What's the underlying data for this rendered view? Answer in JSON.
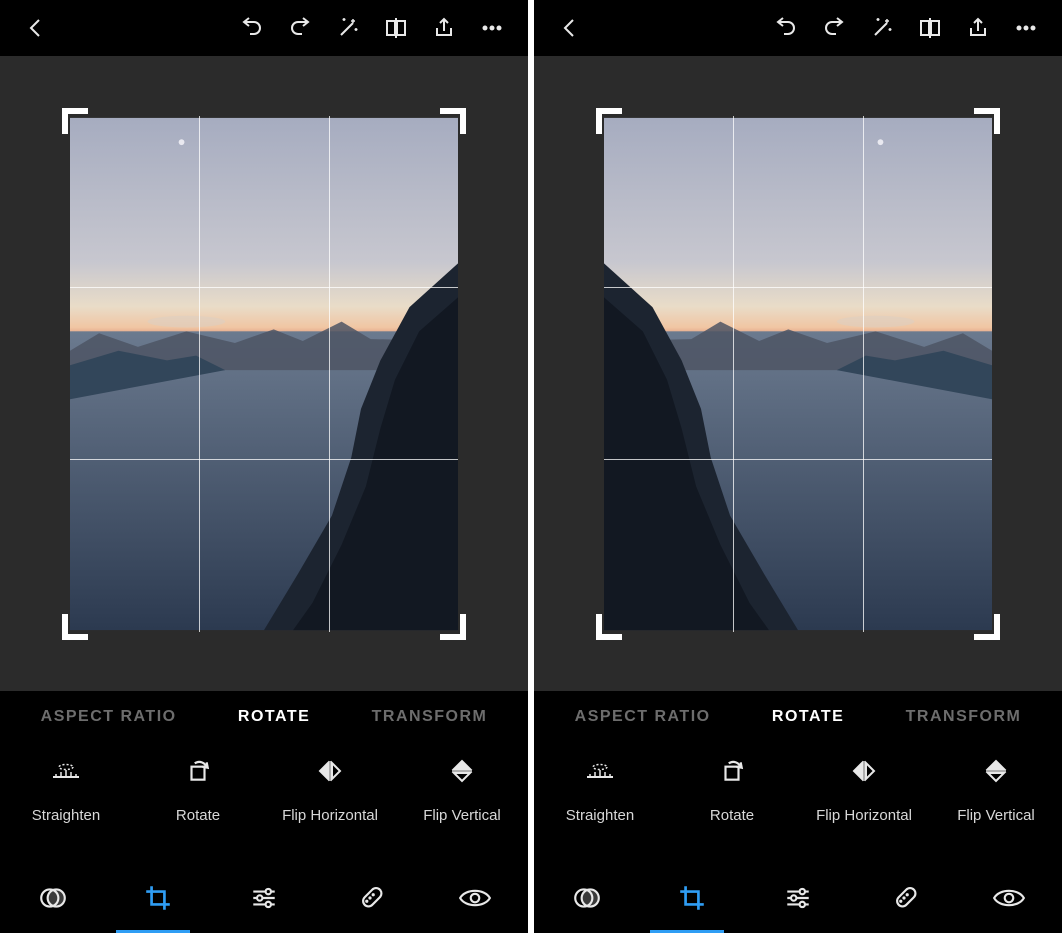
{
  "colors": {
    "accent": "#2f9df4"
  },
  "panels": [
    {
      "flip": false,
      "compareSelected": false
    },
    {
      "flip": true,
      "compareSelected": true
    }
  ],
  "modes": {
    "aspect_ratio": "ASPECT RATIO",
    "rotate": "ROTATE",
    "transform": "TRANSFORM",
    "active": "rotate"
  },
  "tools": {
    "straighten": "Straighten",
    "rotate": "Rotate",
    "flip_h": "Flip Horizontal",
    "flip_v": "Flip Vertical"
  },
  "topbar_icons": [
    "back",
    "undo",
    "redo",
    "auto-enhance",
    "compare",
    "share",
    "more"
  ],
  "bottombar": {
    "icons": [
      "looks",
      "crop",
      "adjust",
      "heal",
      "red-eye"
    ],
    "active": "crop"
  }
}
